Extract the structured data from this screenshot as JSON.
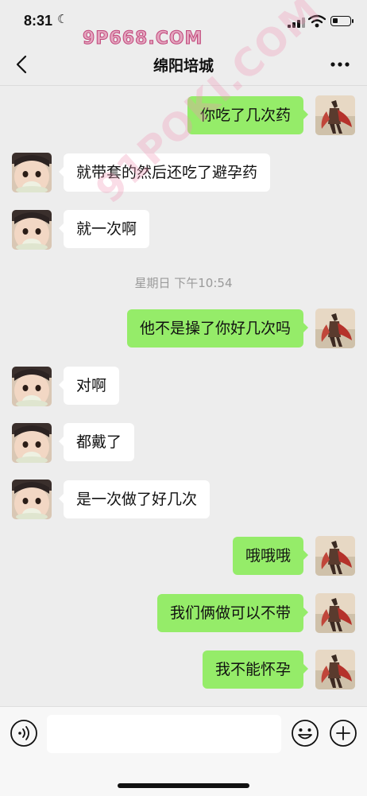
{
  "status_bar": {
    "time": "8:31",
    "battery_level": 0.3
  },
  "watermark": {
    "top": "9P668.COM",
    "diagonal": "91POKI.COM"
  },
  "nav": {
    "title": "绵阳培城",
    "back_icon": "chevron-left-icon",
    "more_icon": "ellipsis-icon"
  },
  "timestamp": "星期日 下午10:54",
  "messages": [
    {
      "side": "right",
      "text": "你吃了几次药"
    },
    {
      "side": "left",
      "text": "就带套的然后还吃了避孕药"
    },
    {
      "side": "left",
      "text": "就一次啊"
    },
    {
      "side": "right",
      "text": "他不是操了你好几次吗"
    },
    {
      "side": "left",
      "text": "对啊"
    },
    {
      "side": "left",
      "text": "都戴了"
    },
    {
      "side": "left",
      "text": "是一次做了好几次"
    },
    {
      "side": "right",
      "text": "哦哦哦"
    },
    {
      "side": "right",
      "text": "我们俩做可以不带"
    },
    {
      "side": "right",
      "text": "我不能怀孕"
    }
  ],
  "input_bar": {
    "value": "",
    "placeholder": "",
    "icons": [
      "voice-icon",
      "emoji-icon",
      "plus-icon"
    ]
  },
  "colors": {
    "background": "#ededed",
    "sent_bubble": "#95ec69",
    "received_bubble": "#ffffff"
  }
}
